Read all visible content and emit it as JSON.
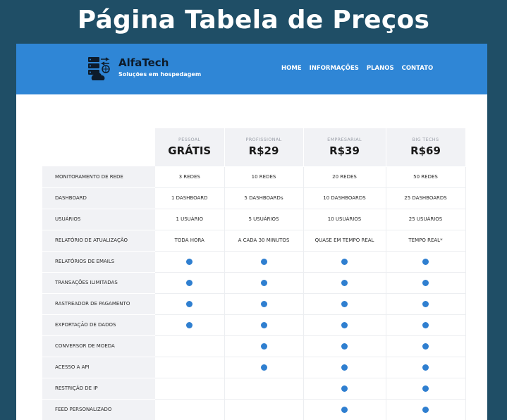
{
  "page": {
    "title": "Página Tabela de Preços"
  },
  "brand": {
    "name": "AlfaTech",
    "tagline": "Soluções em hospedagem",
    "logo_icon": "server-cloud-icon"
  },
  "nav": {
    "items": [
      "HOME",
      "INFORMAÇÕES",
      "PLANOS",
      "CONTATO"
    ]
  },
  "colors": {
    "navbar": "#2f86d6",
    "background": "#1f4e66",
    "check_dot": "#2f7fd0",
    "header_cell": "#f1f2f5"
  },
  "plans": [
    {
      "name": "PESSOAL",
      "price": "GRÁTIS"
    },
    {
      "name": "PROFISSIONAL",
      "price": "R$29"
    },
    {
      "name": "EMPRESARIAL",
      "price": "R$39"
    },
    {
      "name": "BIG TECHS",
      "price": "R$69"
    }
  ],
  "features": [
    {
      "label": "MONITORAMENTO DE REDE",
      "values": [
        "3 REDES",
        "10 REDES",
        "20 REDES",
        "50 REDES"
      ]
    },
    {
      "label": "DASHBOARD",
      "values": [
        "1 DASHBOARD",
        "5 DASHBOARDs",
        "10 DASHBOARDS",
        "25 DASHBOARDS"
      ]
    },
    {
      "label": "USUÁRIOS",
      "values": [
        "1 USUÁRIO",
        "5 USUÁRIOS",
        "10 USUÁRIOS",
        "25 USUÁRIOS"
      ]
    },
    {
      "label": "RELATÓRIO DE ATUALIZAÇÃO",
      "values": [
        "TODA HORA",
        "A CADA 30 MINUTOS",
        "QUASE EM TEMPO REAL",
        "TEMPO REAL*"
      ]
    },
    {
      "label": "RELATÓRIOS DE EMAILS",
      "values": [
        true,
        true,
        true,
        true
      ]
    },
    {
      "label": "TRANSAÇÕES ILIMITADAS",
      "values": [
        true,
        true,
        true,
        true
      ]
    },
    {
      "label": "RASTREADOR DE PAGAMENTO",
      "values": [
        true,
        true,
        true,
        true
      ]
    },
    {
      "label": "EXPORTAÇÃO DE DADOS",
      "values": [
        true,
        true,
        true,
        true
      ]
    },
    {
      "label": "CONVERSOR DE MOEDA",
      "values": [
        false,
        true,
        true,
        true
      ]
    },
    {
      "label": "ACESSO A API",
      "values": [
        false,
        true,
        true,
        true
      ]
    },
    {
      "label": "RESTRIÇÃO DE IP",
      "values": [
        false,
        false,
        true,
        true
      ]
    },
    {
      "label": "FEED PERSONALIZADO",
      "values": [
        false,
        false,
        true,
        true
      ]
    }
  ]
}
